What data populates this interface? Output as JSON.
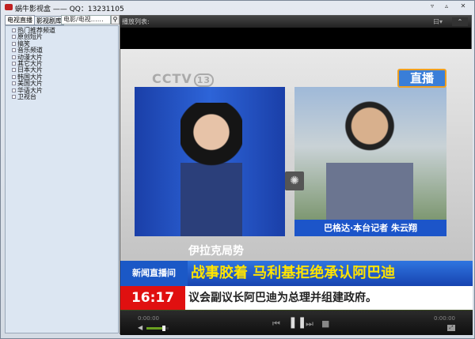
{
  "window": {
    "title": "蜗牛影视盒 —— QQ：13231105",
    "buttons": [
      "▿",
      "▵",
      "✕"
    ]
  },
  "left": {
    "tabs": [
      {
        "label": "电视直播",
        "active": true
      },
      {
        "label": "影视剧库",
        "active": false
      }
    ],
    "search": {
      "value": "电影/电视……",
      "icon": "search-icon"
    },
    "tree": [
      "热门推荐频道",
      "原创短片",
      "搞笑",
      "音乐频道",
      "动漫大片",
      "其它大片",
      "日本大片",
      "韩国大片",
      "美国大片",
      "华语大片",
      "卫视台"
    ]
  },
  "playlist": {
    "label": "播放列表:",
    "mode": "曰▾",
    "collapse": "⌃"
  },
  "video": {
    "channel_logo": "CCTV",
    "channel_number": "13",
    "live_badge": "直播",
    "reporter_caption": "巴格达·本台记者 朱云翔",
    "topic": "伊拉克局势",
    "program": "新闻直播间",
    "headline": "战事胶着 马利基拒绝承认阿巴迪",
    "clock": "16:17",
    "ticker": "议会副议长阿巴迪为总理并组建政府。"
  },
  "controls": {
    "elapsed": "0:00:00",
    "total": "0:00:00",
    "volume_percent": 80
  }
}
